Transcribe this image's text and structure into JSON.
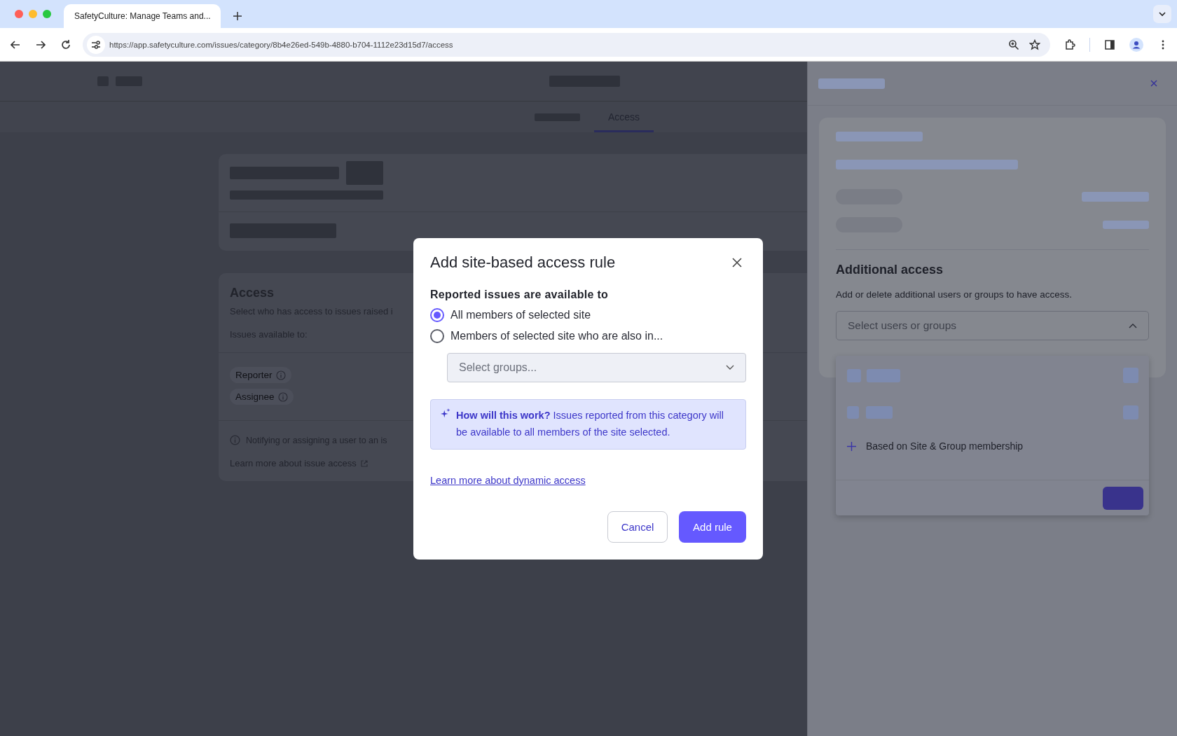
{
  "browser": {
    "tab_title": "SafetyCulture: Manage Teams and...",
    "url": "https://app.safetyculture.com/issues/category/8b4e26ed-549b-4880-b704-1112e23d15d7/access"
  },
  "page_tabs": [
    {
      "label": "Access",
      "selected": true
    }
  ],
  "access_card": {
    "title": "Access",
    "description": "Select who has access to issues raised i",
    "available_label": "Issues available to:",
    "chips": [
      "Reporter",
      "Assignee"
    ],
    "note": "Notifying or assigning a user to an is",
    "link": "Learn more about issue access"
  },
  "side_panel": {
    "title": "Additional access",
    "description": "Add or delete additional users or groups to have access.",
    "select_placeholder": "Select users or groups",
    "expanded": true,
    "menu_option": "Based on Site & Group membership"
  },
  "dialog": {
    "title": "Add site-based access rule",
    "subtitle": "Reported issues are available to",
    "options": [
      {
        "label": "All members of selected site",
        "selected": true
      },
      {
        "label": "Members of selected site who are also in...",
        "selected": false
      }
    ],
    "groups_placeholder": "Select groups...",
    "info": "**How will this work?** Issues reported from this category will be available to all members of the site selected.",
    "link": "Learn more about dynamic access",
    "buttons": [
      "Cancel",
      "Add rule"
    ]
  }
}
